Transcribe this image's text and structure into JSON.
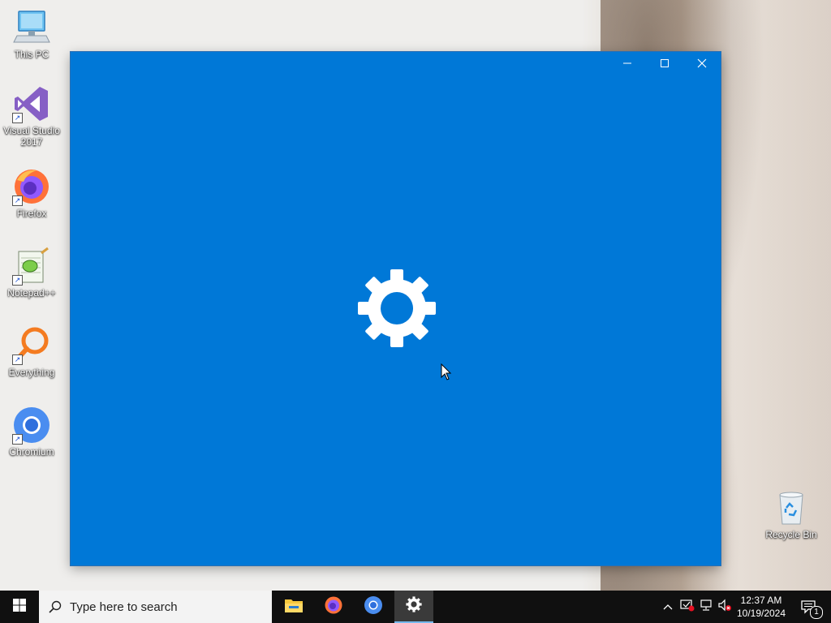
{
  "desktop": {
    "icons": [
      {
        "label": "This PC",
        "icon": "computer-icon"
      },
      {
        "label": "Visual Studio 2017",
        "icon": "visual-studio-icon"
      },
      {
        "label": "Firefox",
        "icon": "firefox-icon"
      },
      {
        "label": "Notepad++",
        "icon": "notepadpp-icon"
      },
      {
        "label": "Everything",
        "icon": "everything-search-icon"
      },
      {
        "label": "Chromium",
        "icon": "chromium-icon"
      },
      {
        "label": "Recycle Bin",
        "icon": "recycle-bin-icon"
      }
    ]
  },
  "window": {
    "app": "Settings",
    "background": "#0078d7",
    "splash_icon": "gear-icon",
    "controls": {
      "minimize": "minimize-icon",
      "maximize": "maximize-icon",
      "close": "close-icon"
    }
  },
  "taskbar": {
    "start_icon": "windows-logo-icon",
    "search": {
      "placeholder": "Type here to search",
      "icon": "search-icon"
    },
    "apps": [
      {
        "name": "File Explorer",
        "icon": "folder-icon",
        "active": false
      },
      {
        "name": "Firefox",
        "icon": "firefox-icon",
        "active": false
      },
      {
        "name": "Chromium",
        "icon": "chromium-icon",
        "active": false
      },
      {
        "name": "Settings",
        "icon": "gear-icon",
        "active": true
      }
    ],
    "tray": {
      "icons": [
        "chevron-up-icon",
        "security-alert-icon",
        "network-icon",
        "volume-muted-icon"
      ],
      "time": "12:37 AM",
      "date": "10/19/2024",
      "notification_count": "1"
    }
  }
}
